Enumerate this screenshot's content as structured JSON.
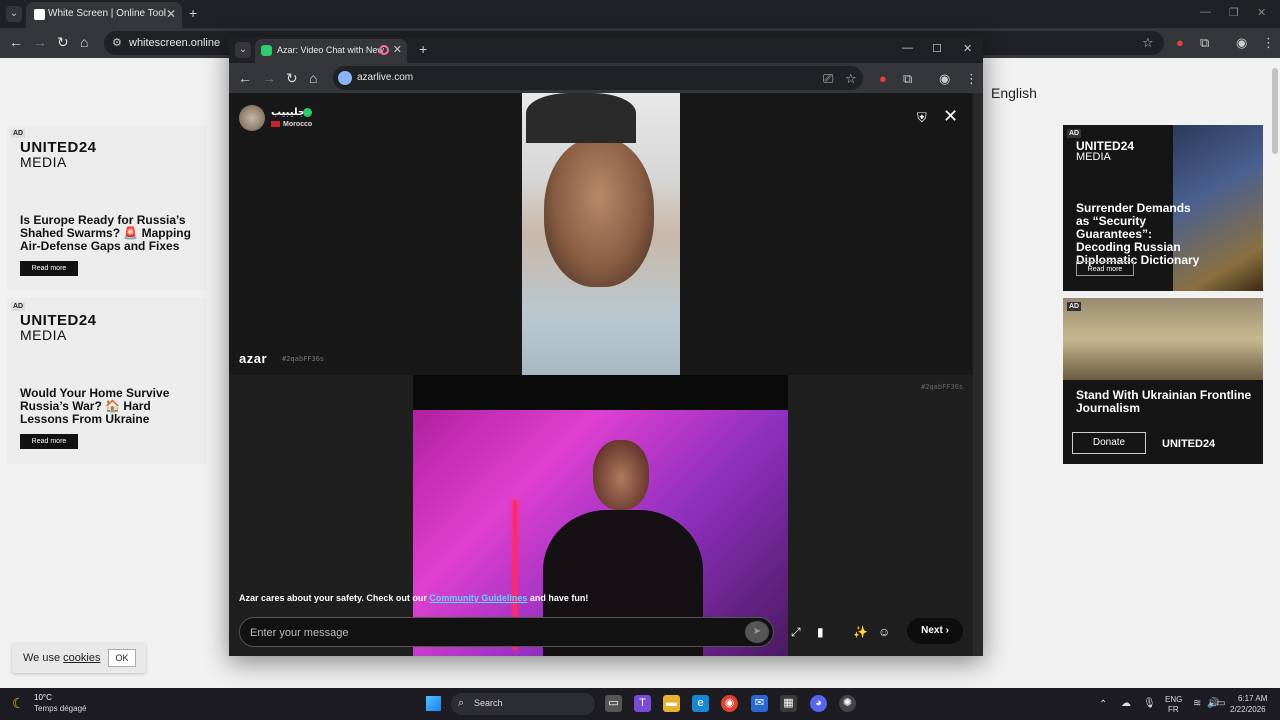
{
  "outer_browser": {
    "tab_title": "White Screen | Online Tool",
    "url": "whitescreen.online",
    "language": "English"
  },
  "ads": {
    "ad_tag": "AD",
    "brand_top": "UNITED24",
    "brand_bottom": "MEDIA",
    "left1_headline": "Is Europe Ready for Russia’s Shahed Swarms? 🚨 Mapping Air-Defense Gaps and Fixes",
    "left2_headline": "Would Your Home Survive Russia’s War? 🏠 Hard Lessons From Ukraine",
    "read_more": "Read more",
    "right1_headline": "Surrender Demands as “Security Guarantees”: Decoding Russian Diplomatic Dictionary",
    "right2_headline": "Stand With Ukrainian Frontline Journalism",
    "donate": "Donate",
    "u24": "UNITED24"
  },
  "cookie": {
    "text": "We use",
    "link": "cookies",
    "ok": "OK"
  },
  "inner_browser": {
    "tab_title": "Azar: Video Chat with New",
    "url": "azarlive.com"
  },
  "azar": {
    "username": "جليبيب",
    "country": "Morocco",
    "logo": "azar",
    "hash": "#2qabFF36s",
    "safety_pre": "Azar cares about your safety. Check out our ",
    "safety_link": "Community Guidelines",
    "safety_post": " and have fun!",
    "message_placeholder": "Enter your message",
    "next": "Next"
  },
  "taskbar": {
    "temp": "10°C",
    "weather": "Temps dégagé",
    "search": "Search",
    "lang1": "ENG",
    "lang2": "FR",
    "time": "6:17 AM",
    "date": "2/22/2026"
  },
  "icons": [
    "tab-menu-icon",
    "back-icon",
    "forward-icon",
    "reload-icon",
    "home-icon",
    "star-icon",
    "extensions-icon",
    "profile-icon",
    "menu-icon",
    "shield-icon",
    "close-icon",
    "send-icon",
    "expand-icon",
    "phone-icon",
    "magic-icon",
    "emoji-icon",
    "chevron-right-icon",
    "windows-icon",
    "search-icon",
    "wifi-icon",
    "volume-icon",
    "battery-icon"
  ]
}
